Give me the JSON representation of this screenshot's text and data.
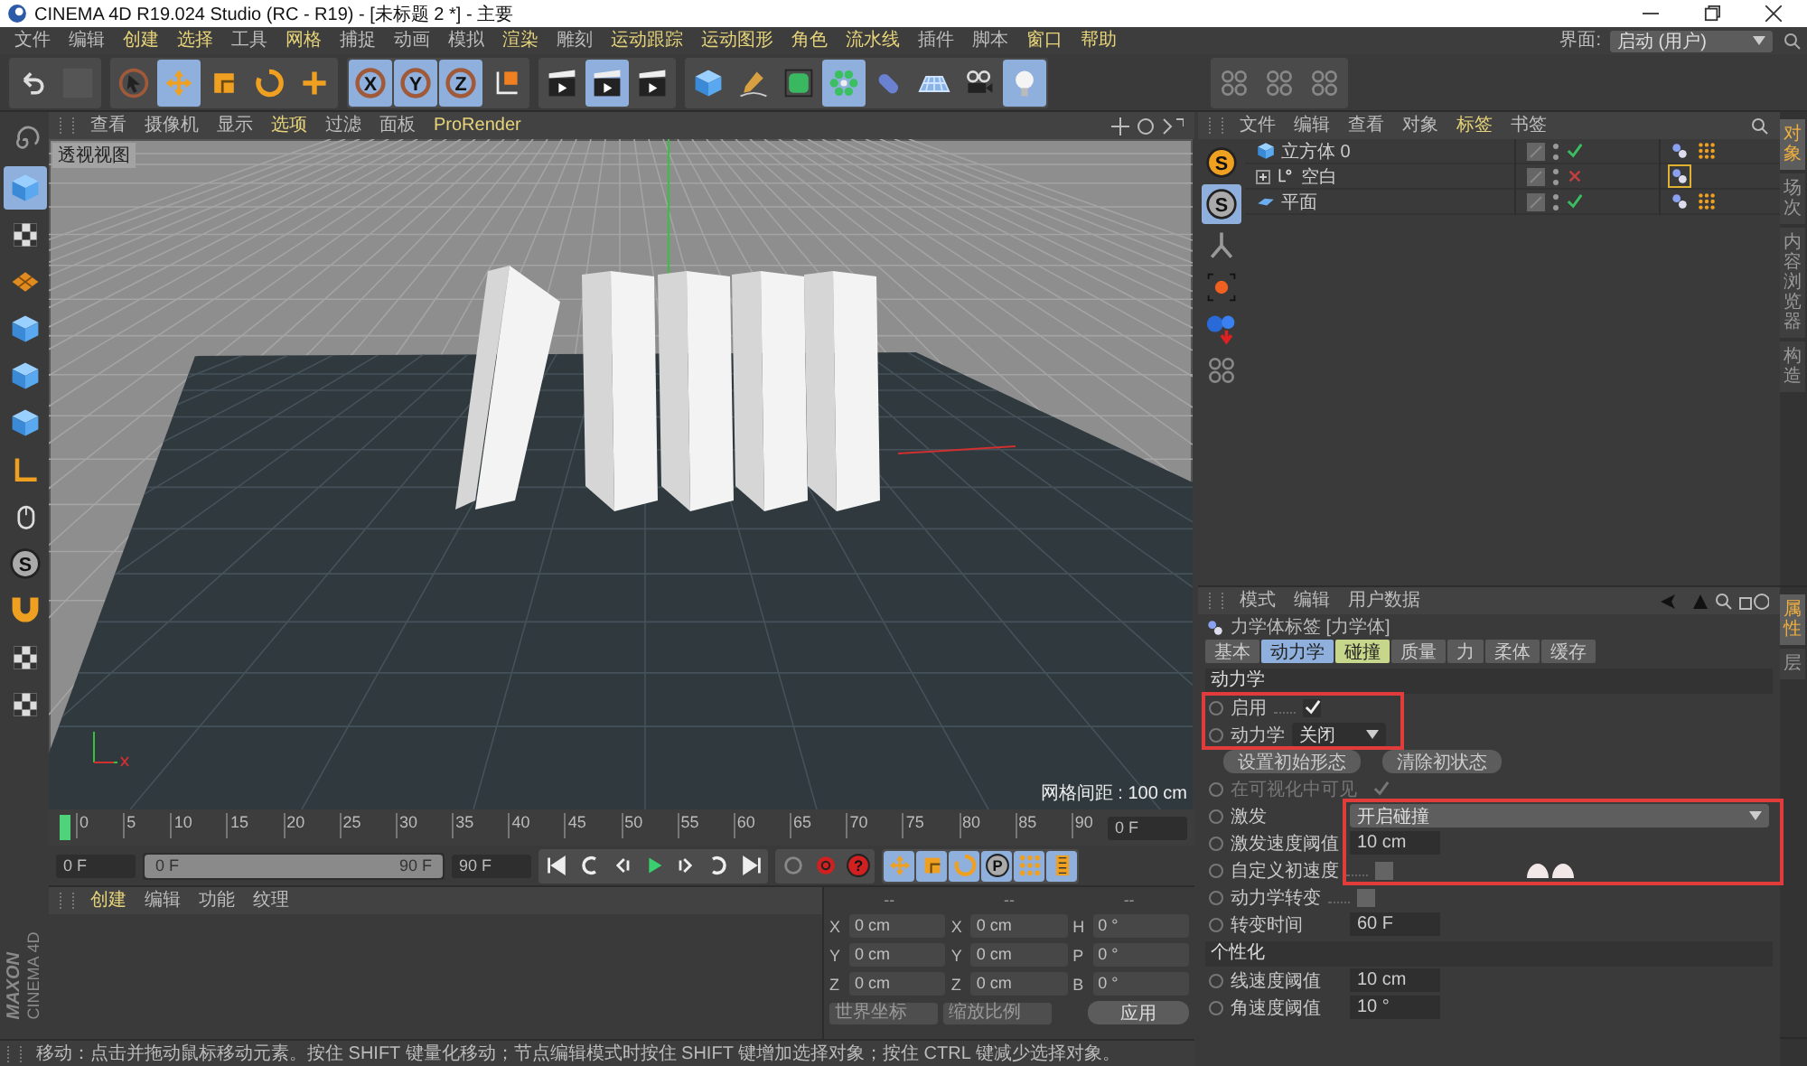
{
  "window": {
    "title": "CINEMA 4D R19.024 Studio (RC - R19) - [未标题 2 *] - 主要"
  },
  "menu": [
    {
      "label": "文件",
      "highlighted": false
    },
    {
      "label": "编辑",
      "highlighted": false
    },
    {
      "label": "创建",
      "highlighted": true
    },
    {
      "label": "选择",
      "highlighted": true
    },
    {
      "label": "工具",
      "highlighted": false
    },
    {
      "label": "网格",
      "highlighted": true
    },
    {
      "label": "捕捉",
      "highlighted": false
    },
    {
      "label": "动画",
      "highlighted": false
    },
    {
      "label": "模拟",
      "highlighted": false
    },
    {
      "label": "渲染",
      "highlighted": true
    },
    {
      "label": "雕刻",
      "highlighted": false
    },
    {
      "label": "运动跟踪",
      "highlighted": true
    },
    {
      "label": "运动图形",
      "highlighted": true
    },
    {
      "label": "角色",
      "highlighted": true
    },
    {
      "label": "流水线",
      "highlighted": true
    },
    {
      "label": "插件",
      "highlighted": false
    },
    {
      "label": "脚本",
      "highlighted": false
    },
    {
      "label": "窗口",
      "highlighted": true
    },
    {
      "label": "帮助",
      "highlighted": true
    }
  ],
  "layout": {
    "label": "界面:",
    "value": "启动 (用户)"
  },
  "toolbar": [
    [
      {
        "kind": "undo",
        "active": false
      },
      {
        "kind": "blank",
        "active": false
      }
    ],
    [
      {
        "kind": "select",
        "active": false
      },
      {
        "kind": "move",
        "active": true
      },
      {
        "kind": "scale",
        "active": false
      },
      {
        "kind": "rotate",
        "active": false
      },
      {
        "kind": "plus",
        "active": false
      }
    ],
    [
      {
        "kind": "axis",
        "label": "X",
        "active": true
      },
      {
        "kind": "axis",
        "label": "Y",
        "active": true
      },
      {
        "kind": "axis",
        "label": "Z",
        "active": true
      },
      {
        "kind": "coord",
        "active": false
      }
    ],
    [
      {
        "kind": "clapper",
        "active": false
      },
      {
        "kind": "clapper",
        "active": true
      },
      {
        "kind": "clapper",
        "active": false
      }
    ],
    [
      {
        "kind": "cube",
        "active": false
      },
      {
        "kind": "pen",
        "active": false
      },
      {
        "kind": "cage",
        "active": false
      },
      {
        "kind": "ring",
        "active": true
      },
      {
        "kind": "capsule",
        "active": false
      },
      {
        "kind": "floor",
        "active": false
      },
      {
        "kind": "camera",
        "active": false
      },
      {
        "kind": "light",
        "active": true
      }
    ],
    [
      {
        "kind": "cluster",
        "active": false
      },
      {
        "kind": "cluster",
        "active": false
      },
      {
        "kind": "cluster",
        "active": false
      }
    ]
  ],
  "left_tools": [
    {
      "kind": "swirl",
      "active": false
    },
    {
      "kind": "cube",
      "active": true
    },
    {
      "kind": "checker",
      "active": false
    },
    {
      "kind": "tile",
      "active": false
    },
    {
      "kind": "cube",
      "active": false
    },
    {
      "kind": "cube",
      "active": false
    },
    {
      "kind": "cube",
      "active": false
    },
    {
      "kind": "corner",
      "active": false
    },
    {
      "kind": "mouse",
      "active": false
    },
    {
      "kind": "letter",
      "label": "S",
      "active": false
    },
    {
      "kind": "magnet",
      "active": false
    },
    {
      "kind": "checker",
      "active": false
    },
    {
      "kind": "checker",
      "active": false
    }
  ],
  "viewport": {
    "menu": [
      {
        "label": "查看",
        "highlighted": false
      },
      {
        "label": "摄像机",
        "highlighted": false
      },
      {
        "label": "显示",
        "highlighted": false
      },
      {
        "label": "选项",
        "highlighted": true
      },
      {
        "label": "过滤",
        "highlighted": false
      },
      {
        "label": "面板",
        "highlighted": false
      },
      {
        "label": "ProRender",
        "highlighted": true
      }
    ],
    "view_label": "透视视图",
    "grid_info": "网格间距 : 100 cm"
  },
  "timeline": {
    "ticks": [
      "0",
      "5",
      "10",
      "15",
      "20",
      "25",
      "30",
      "35",
      "40",
      "45",
      "50",
      "55",
      "60",
      "65",
      "70",
      "75",
      "80",
      "85",
      "90"
    ],
    "level": 0,
    "frame": "0 F"
  },
  "transport": {
    "start": "0 F",
    "range": {
      "start": "0 F",
      "end": "90 F",
      "level": 1
    },
    "end": "90 F",
    "buttons": [
      {
        "kind": "to-start",
        "active": false
      },
      {
        "kind": "loop-back",
        "active": false
      },
      {
        "kind": "step-back",
        "active": false
      },
      {
        "kind": "play",
        "active": false
      },
      {
        "kind": "step-fwd",
        "active": false
      },
      {
        "kind": "loop-fwd",
        "active": false
      },
      {
        "kind": "to-end",
        "active": false
      },
      {
        "kind": "key",
        "active": false
      },
      {
        "kind": "record",
        "active": false
      },
      {
        "kind": "letter-red",
        "label": "?",
        "active": false
      },
      {
        "kind": "move",
        "active": true
      },
      {
        "kind": "scale",
        "active": true
      },
      {
        "kind": "rotate",
        "active": true
      },
      {
        "kind": "letter",
        "label": "P",
        "active": true
      },
      {
        "kind": "dots",
        "active": true
      },
      {
        "kind": "film",
        "active": true
      }
    ]
  },
  "materials": {
    "menu": [
      {
        "label": "创建",
        "highlighted": true
      },
      {
        "label": "编辑",
        "highlighted": false
      },
      {
        "label": "功能",
        "highlighted": false
      },
      {
        "label": "纹理",
        "highlighted": false
      }
    ]
  },
  "coordinates": {
    "headers": [
      "--",
      "--",
      "--"
    ],
    "rows": [
      [
        {
          "axis": "X",
          "value": "0 cm"
        },
        {
          "axis": "X",
          "value": "0 cm"
        },
        {
          "axis": "H",
          "value": "0 °"
        }
      ],
      [
        {
          "axis": "Y",
          "value": "0 cm"
        },
        {
          "axis": "Y",
          "value": "0 cm"
        },
        {
          "axis": "P",
          "value": "0 °"
        }
      ],
      [
        {
          "axis": "Z",
          "value": "0 cm"
        },
        {
          "axis": "Z",
          "value": "0 cm"
        },
        {
          "axis": "B",
          "value": "0 °"
        }
      ]
    ],
    "dropdowns": [
      "世界坐标",
      "缩放比例"
    ],
    "apply": "应用"
  },
  "brand": {
    "line1": "MAXON",
    "line2": "CINEMA 4D"
  },
  "status_bar": "移动：点击并拖动鼠标移动元素。按住 SHIFT 键量化移动；节点编辑模式时按住 SHIFT 键增加选择对象；按住 CTRL 键减少选择对象。",
  "object_manager": {
    "menu": [
      {
        "label": "文件",
        "highlighted": false
      },
      {
        "label": "编辑",
        "highlighted": false
      },
      {
        "label": "查看",
        "highlighted": false
      },
      {
        "label": "对象",
        "highlighted": false
      },
      {
        "label": "标签",
        "highlighted": true
      },
      {
        "label": "书签",
        "highlighted": false
      }
    ],
    "side_tools": [
      {
        "kind": "letter-orange",
        "label": "S",
        "active": false
      },
      {
        "kind": "letter",
        "label": "S",
        "active": true
      },
      {
        "kind": "bone",
        "active": false
      },
      {
        "kind": "target",
        "active": false
      },
      {
        "kind": "molecule",
        "active": false
      },
      {
        "kind": "cluster",
        "active": false
      }
    ],
    "objects": [
      {
        "name": "立方体 0",
        "kind": "cube",
        "enabled": true,
        "tags": [
          {
            "kind": "spheres",
            "selected": false
          },
          {
            "kind": "dots",
            "selected": false
          }
        ]
      },
      {
        "name": "空白",
        "kind": "null",
        "expanded": false,
        "enabled": false,
        "tags": [
          {
            "kind": "spheres",
            "selected": true
          }
        ]
      },
      {
        "name": "平面",
        "kind": "plane",
        "enabled": true,
        "tags": [
          {
            "kind": "spheres",
            "selected": false
          },
          {
            "kind": "dots",
            "selected": false
          }
        ]
      }
    ]
  },
  "attributes": {
    "menu": [
      {
        "label": "模式",
        "highlighted": false
      },
      {
        "label": "编辑",
        "highlighted": false
      },
      {
        "label": "用户数据",
        "highlighted": false
      }
    ],
    "title": "力学体标签 [力学体]",
    "tabs": [
      {
        "label": "基本",
        "selected": false,
        "highlighted": false
      },
      {
        "label": "动力学",
        "selected": true,
        "highlighted": false
      },
      {
        "label": "碰撞",
        "selected": false,
        "highlighted": true
      },
      {
        "label": "质量",
        "selected": false,
        "highlighted": false
      },
      {
        "label": "力",
        "selected": false,
        "highlighted": false
      },
      {
        "label": "柔体",
        "selected": false,
        "highlighted": false
      },
      {
        "label": "缓存",
        "selected": false,
        "highlighted": false
      }
    ],
    "rows": [
      {
        "kind": "section",
        "label": "动力学"
      },
      {
        "kind": "checkbox",
        "label": "启用",
        "checked": true,
        "disabled": false
      },
      {
        "kind": "dropdown",
        "label": "动力学",
        "value": "关闭"
      },
      {
        "kind": "buttons",
        "buttons": [
          "设置初始形态",
          "清除初状态"
        ]
      },
      {
        "kind": "checkbox",
        "label": "在可视化中可见",
        "checked": true,
        "disabled": true
      },
      {
        "kind": "select",
        "label": "激发",
        "value": "开启碰撞"
      },
      {
        "kind": "field",
        "label": "激发速度阈值",
        "value": "10 cm"
      },
      {
        "kind": "checkbox",
        "label": "自定义初速度",
        "checked": false,
        "disabled": false
      },
      {
        "kind": "checkbox",
        "label": "动力学转变",
        "checked": false,
        "disabled": false
      },
      {
        "kind": "field",
        "label": "转变时间",
        "value": "60 F"
      },
      {
        "kind": "section",
        "label": "个性化"
      },
      {
        "kind": "field",
        "label": "线速度阈值",
        "value": "10 cm"
      },
      {
        "kind": "field",
        "label": "角速度阈值",
        "value": "10 °"
      }
    ]
  },
  "side_tabs": {
    "top": [
      {
        "label": "对象",
        "selected": true
      },
      {
        "label": "场次",
        "selected": false
      },
      {
        "label": "内容浏览器",
        "selected": false
      },
      {
        "label": "构造",
        "selected": false
      }
    ],
    "bottom": [
      {
        "label": "属性",
        "selected": true
      },
      {
        "label": "层",
        "selected": false
      }
    ]
  }
}
